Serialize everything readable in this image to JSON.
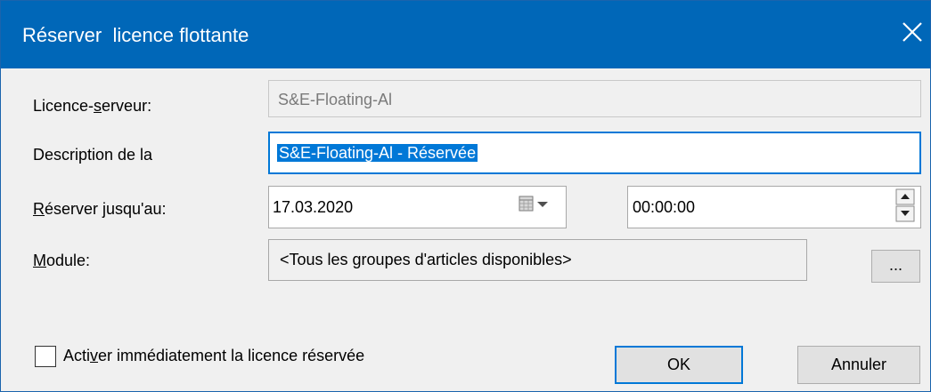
{
  "dialog": {
    "title": "Réserver  licence flottante",
    "close_icon": "close-icon"
  },
  "server_license": {
    "label": "Licence-serveur:",
    "value": "S&E-Floating-Al"
  },
  "description": {
    "label": "Description de la",
    "value": "S&E-Floating-Al - Réservée"
  },
  "reserve_until": {
    "label": "Réserver jusqu'au:",
    "date_value": "17.03.2020",
    "time_value": "00:00:00",
    "calendar_icon": "calendar-dropdown-icon",
    "spinner_icon": "spin-up-down-icon"
  },
  "module": {
    "label": "Module:",
    "value": "<Tous les groupes d'articles disponibles>",
    "browse_label": "..."
  },
  "activate": {
    "label": "Activer immédiatement la licence réservée",
    "checked": false
  },
  "buttons": {
    "ok": "OK",
    "cancel": "Annuler"
  },
  "colors": {
    "titlebar": "#0067b8",
    "selection": "#0078d7",
    "focus_border": "#0078d7",
    "dialog_background": "#f0f0f0"
  }
}
